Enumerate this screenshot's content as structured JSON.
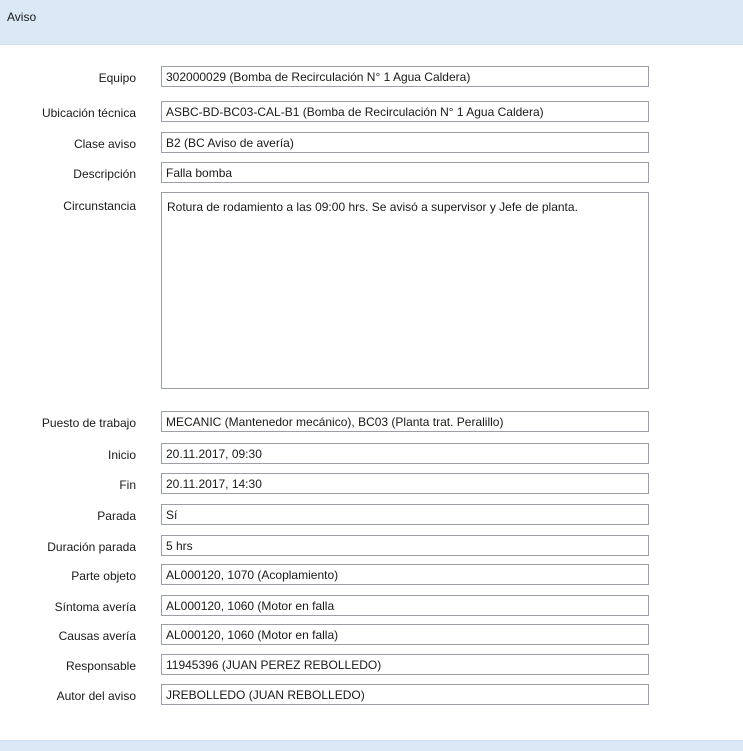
{
  "header": {
    "title": "Aviso"
  },
  "fields": {
    "equipo": {
      "label": "Equipo",
      "value": "302000029 (Bomba de Recirculación N° 1 Agua Caldera)"
    },
    "ubicacion": {
      "label": "Ubicación técnica",
      "value": "ASBC-BD-BC03-CAL-B1 (Bomba de Recirculación N° 1 Agua Caldera)"
    },
    "clase": {
      "label": "Clase aviso",
      "value": "B2 (BC Aviso de avería)"
    },
    "descripcion": {
      "label": "Descripción",
      "value": "Falla bomba"
    },
    "circunstancia": {
      "label": "Circunstancia",
      "value": "Rotura de rodamiento a las 09:00 hrs. Se avisó a supervisor y Jefe de planta."
    },
    "puesto": {
      "label": "Puesto de trabajo",
      "value": "MECANIC (Mantenedor mecánico), BC03 (Planta trat. Peralillo)"
    },
    "inicio": {
      "label": "Inicio",
      "value": "20.11.2017, 09:30"
    },
    "fin": {
      "label": "Fin",
      "value": "20.11.2017, 14:30"
    },
    "parada": {
      "label": "Parada",
      "value": "Sí"
    },
    "duracion": {
      "label": "Duración parada",
      "value": "5 hrs"
    },
    "parte": {
      "label": "Parte objeto",
      "value": "AL000120, 1070 (Acoplamiento)"
    },
    "sintoma": {
      "label": "Síntoma avería",
      "value": "AL000120, 1060 (Motor en falla"
    },
    "causas": {
      "label": "Causas avería",
      "value": "AL000120, 1060 (Motor en falla)"
    },
    "responsable": {
      "label": "Responsable",
      "value": "11945396 (JUAN PEREZ REBOLLEDO)"
    },
    "autor": {
      "label": "Autor del aviso",
      "value": "JREBOLLEDO (JUAN REBOLLEDO)"
    }
  }
}
